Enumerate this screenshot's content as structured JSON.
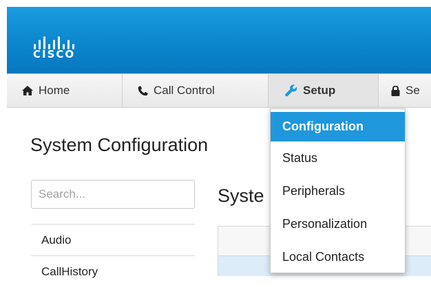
{
  "brand": {
    "logo_text": "CISCO"
  },
  "nav": {
    "items": [
      {
        "label": "Home",
        "icon": "home-icon"
      },
      {
        "label": "Call Control",
        "icon": "phone-icon"
      },
      {
        "label": "Setup",
        "icon": "wrench-icon",
        "active": true
      },
      {
        "label": "Se",
        "icon": "lock-icon"
      }
    ]
  },
  "setup_menu": {
    "items": [
      {
        "label": "Configuration",
        "selected": true
      },
      {
        "label": "Status"
      },
      {
        "label": "Peripherals"
      },
      {
        "label": "Personalization"
      },
      {
        "label": "Local Contacts"
      }
    ]
  },
  "page": {
    "title": "System Configuration"
  },
  "search": {
    "placeholder": "Search..."
  },
  "sidebar": {
    "items": [
      {
        "label": "Audio"
      },
      {
        "label": "CallHistory"
      }
    ]
  },
  "main": {
    "section_title": "Syste"
  },
  "colors": {
    "header_blue": "#0a86cd",
    "menu_selected": "#1f97dc",
    "row_highlight": "#dcecf8"
  }
}
